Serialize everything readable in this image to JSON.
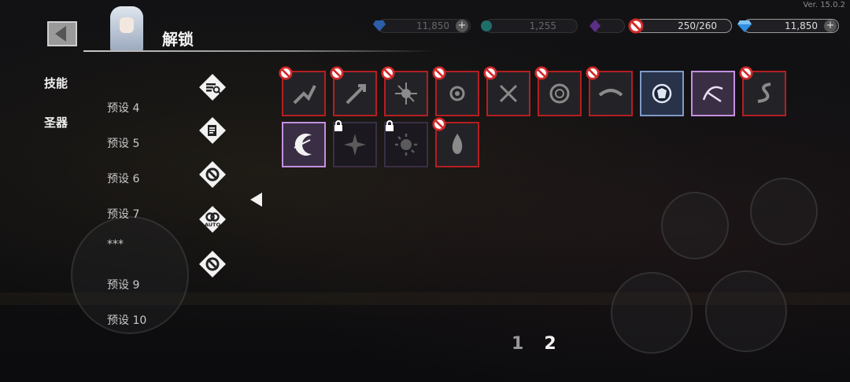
{
  "version": "Ver. 15.0.2",
  "header": {
    "title": "解锁"
  },
  "currencies": [
    {
      "icon": "gem-icon",
      "value": "11,850",
      "color": "#3b7bd8",
      "active": false
    },
    {
      "icon": "coin-icon",
      "value": "1,255",
      "color": "#2aa6a0",
      "active": false
    },
    {
      "icon": "crystal-icon",
      "value": "",
      "color": "#7a3fb0",
      "active": false
    },
    {
      "icon": "ban-icon",
      "value": "250/260",
      "color": "#d32a2a",
      "active": true
    },
    {
      "icon": "diamond-icon",
      "value": "11,850",
      "color": "#2f8de0",
      "active": true
    }
  ],
  "side_tabs": [
    "技能",
    "圣器"
  ],
  "presets": [
    "预设 4",
    "预设 5",
    "预设 6",
    "预设 7",
    "***",
    "预设 9",
    "预设 10"
  ],
  "tool_icons": [
    "list-search-icon",
    "scroll-icon",
    "cancel-loop-icon",
    "auto-loop-icon",
    "cancel-loop-alt-icon"
  ],
  "auto_label": "AUTO",
  "skills_row1": [
    {
      "name": "skill-rising-strike",
      "state": "banned"
    },
    {
      "name": "skill-sword-rise",
      "state": "banned"
    },
    {
      "name": "skill-spiked-orb",
      "state": "banned"
    },
    {
      "name": "skill-burst-eye",
      "state": "banned"
    },
    {
      "name": "skill-cross-blades",
      "state": "banned"
    },
    {
      "name": "skill-vortex",
      "state": "banned"
    },
    {
      "name": "skill-dash-swipe",
      "state": "banned"
    },
    {
      "name": "skill-shield-orb",
      "state": "selected-blue"
    },
    {
      "name": "skill-shadow-dash",
      "state": "selected-purple"
    },
    {
      "name": "skill-serpent",
      "state": "banned"
    }
  ],
  "skills_row2": [
    {
      "name": "skill-crescent-slash",
      "state": "selected-purple"
    },
    {
      "name": "skill-shuriken",
      "state": "locked"
    },
    {
      "name": "skill-sun-gear",
      "state": "locked"
    },
    {
      "name": "skill-flame-drop",
      "state": "banned"
    }
  ],
  "pagination": {
    "pages": [
      "1",
      "2"
    ],
    "current": 2
  }
}
